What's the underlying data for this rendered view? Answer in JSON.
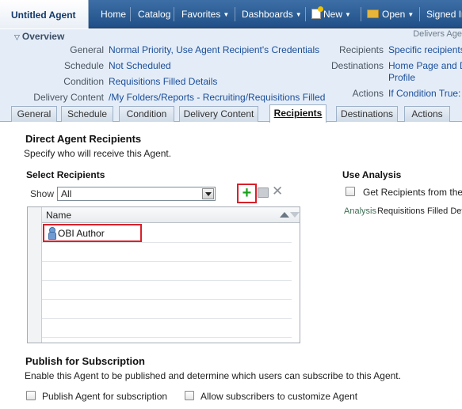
{
  "header": {
    "title": "Untitled Agent",
    "nav": [
      {
        "label": "Home",
        "has_menu": false
      },
      {
        "label": "Catalog",
        "has_menu": false
      },
      {
        "label": "Favorites",
        "has_menu": true
      },
      {
        "label": "Dashboards",
        "has_menu": true
      },
      {
        "label": "New",
        "has_menu": true,
        "icon": "new-document-icon"
      },
      {
        "label": "Open",
        "has_menu": true,
        "icon": "folder-icon"
      },
      {
        "label": "Signed In",
        "has_menu": false
      }
    ]
  },
  "overview": {
    "title": "Overview",
    "delivers": "Delivers Age",
    "left": [
      {
        "label": "General",
        "value": "Normal Priority, Use Agent Recipient's Credentials"
      },
      {
        "label": "Schedule",
        "value": "Not Scheduled"
      },
      {
        "label": "Condition",
        "value": "Requisitions Filled Details"
      },
      {
        "label": "Delivery Content",
        "value": "/My Folders/Reports - Recruiting/Requisitions Filled"
      }
    ],
    "right": [
      {
        "label": "Recipients",
        "value": "Specific recipients"
      },
      {
        "label": "Destinations",
        "value": "Home Page and Das",
        "value2": "Profile"
      },
      {
        "label": "Actions",
        "value": "If Condition True: <"
      }
    ]
  },
  "tabs": [
    {
      "label": "General",
      "active": false
    },
    {
      "label": "Schedule",
      "active": false
    },
    {
      "label": "Condition",
      "active": false
    },
    {
      "label": "Delivery Content",
      "active": false
    },
    {
      "label": "Recipients",
      "active": true
    },
    {
      "label": "Destinations",
      "active": false
    },
    {
      "label": "Actions",
      "active": false
    }
  ],
  "recipients": {
    "title": "Direct Agent Recipients",
    "description": "Specify who will receive this Agent.",
    "select_title": "Select Recipients",
    "show_label": "Show",
    "show_value": "All",
    "table": {
      "column": "Name",
      "rows": [
        "OBI Author"
      ]
    }
  },
  "use_analysis": {
    "title": "Use Analysis",
    "checkbox_label": "Get Recipients from the Ar",
    "checked": false,
    "analysis_label": "Analysis",
    "analysis_value": "Requisitions Filled Deta"
  },
  "publish": {
    "title": "Publish for Subscription",
    "description": "Enable this Agent to be published and determine which users can subscribe to this Agent.",
    "publish_label": "Publish Agent for subscription",
    "customize_label": "Allow subscribers to customize Agent",
    "publish_checked": false,
    "customize_checked": false
  },
  "colors": {
    "accent": "#1f4f86",
    "link": "#1a4d9a",
    "highlight": "#d9202a",
    "add_green": "#16a21a"
  }
}
